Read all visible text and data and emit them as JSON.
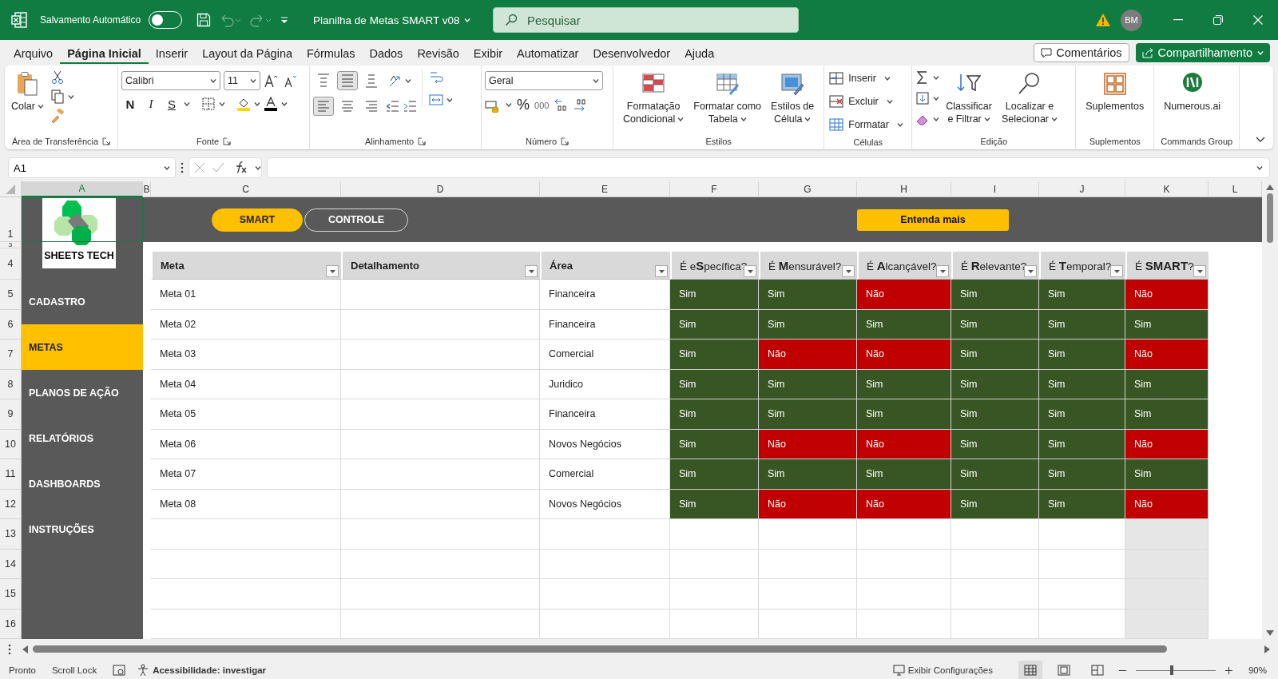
{
  "titlebar": {
    "autosave": {
      "label": "Salvamento Automático",
      "on": false
    },
    "title": "Planilha de Metas SMART v08",
    "search": {
      "placeholder": "Pesquisar"
    },
    "avatar": "BM"
  },
  "menu": {
    "tabs": [
      {
        "label": "Arquivo",
        "selected": false
      },
      {
        "label": "Página Inicial",
        "selected": true
      },
      {
        "label": "Inserir",
        "selected": false
      },
      {
        "label": "Layout da Página",
        "selected": false
      },
      {
        "label": "Fórmulas",
        "selected": false
      },
      {
        "label": "Dados",
        "selected": false
      },
      {
        "label": "Revisão",
        "selected": false
      },
      {
        "label": "Exibir",
        "selected": false
      },
      {
        "label": "Automatizar",
        "selected": false
      },
      {
        "label": "Desenvolvedor",
        "selected": false
      },
      {
        "label": "Ajuda",
        "selected": false
      }
    ],
    "comments": "Comentários",
    "share": "Compartilhamento"
  },
  "ribbon": {
    "groups": [
      {
        "kind": "clipboard",
        "label": "Área de Transferência",
        "paste": "Colar"
      },
      {
        "kind": "font",
        "label": "Fonte",
        "font_name": "Calibri",
        "font_size": "11",
        "styles": [
          "N",
          "I",
          "S"
        ]
      },
      {
        "kind": "alignment",
        "label": "Alinhamento",
        "vertical": [
          {
            "selected": false
          },
          {
            "selected": true
          },
          {
            "selected": false
          }
        ],
        "horizontal": [
          {
            "selected": true
          },
          {
            "selected": false
          },
          {
            "selected": false
          }
        ]
      },
      {
        "kind": "number",
        "label": "Número",
        "format": "Geral",
        "symbols": [
          "%",
          "000"
        ]
      },
      {
        "kind": "large",
        "label": "Estilos",
        "buttons": [
          {
            "kind": "conditional",
            "lines": [
              "Formatação",
              "Condicional"
            ],
            "menu": true
          },
          {
            "kind": "table",
            "lines": [
              "Formatar como",
              "Tabela"
            ],
            "menu": true
          },
          {
            "kind": "cellstyle",
            "lines": [
              "Estilos de",
              "Célula"
            ],
            "menu": true
          }
        ]
      },
      {
        "kind": "cells",
        "label": "Células",
        "buttons": [
          {
            "kind": "insert",
            "label": "Inserir"
          },
          {
            "kind": "delete",
            "label": "Excluir"
          },
          {
            "kind": "format",
            "label": "Formatar"
          }
        ]
      },
      {
        "kind": "editing",
        "label": "Edição",
        "buttons": [
          {
            "kind": "sort",
            "lines": [
              "Classificar",
              "e Filtrar"
            ],
            "menu": true
          },
          {
            "kind": "find",
            "lines": [
              "Localizar e",
              "Selecionar"
            ],
            "menu": true
          }
        ]
      },
      {
        "kind": "large",
        "label": "Suplementos",
        "buttons": [
          {
            "kind": "addins",
            "lines": [
              "Suplementos"
            ],
            "menu": false
          }
        ]
      },
      {
        "kind": "large",
        "label": "Commands Group",
        "buttons": [
          {
            "kind": "numerous",
            "lines": [
              "Numerous.ai"
            ],
            "menu": false
          }
        ]
      }
    ]
  },
  "formula_bar": {
    "name_box": "A1"
  },
  "sheet": {
    "columns": [
      {
        "label": "A",
        "selected": true
      },
      {
        "label": "B",
        "selected": false
      },
      {
        "label": "C",
        "selected": false
      },
      {
        "label": "D",
        "selected": false
      },
      {
        "label": "E",
        "selected": false
      },
      {
        "label": "F",
        "selected": false
      },
      {
        "label": "G",
        "selected": false
      },
      {
        "label": "H",
        "selected": false
      },
      {
        "label": "I",
        "selected": false
      },
      {
        "label": "J",
        "selected": false
      },
      {
        "label": "K",
        "selected": false
      },
      {
        "label": "L",
        "selected": false
      }
    ],
    "row_numbers": [
      "1",
      "3",
      "4",
      "5",
      "6",
      "7",
      "8",
      "9",
      "10",
      "11",
      "12",
      "13",
      "14",
      "15",
      "16"
    ],
    "logo": "SHEETS TECH",
    "nav_buttons": [
      {
        "label": "SMART",
        "selected": true
      },
      {
        "label": "CONTROLE",
        "selected": false
      }
    ],
    "info_button": "Entenda mais",
    "sidebar": [
      {
        "label": "CADASTRO",
        "selected": false
      },
      {
        "label": "METAS",
        "selected": true
      },
      {
        "label": "PLANOS DE AÇÃO",
        "selected": false
      },
      {
        "label": "RELATÓRIOS",
        "selected": false
      },
      {
        "label": "DASHBOARDS",
        "selected": false
      },
      {
        "label": "INSTRUÇÕES",
        "selected": false
      }
    ],
    "table": {
      "columns": [
        "Meta",
        "Detalhamento",
        "Área",
        "É e**S**pecífica?",
        "É **M**ensurável?",
        "É **A**lcançável?",
        "É **R**elevante?",
        "É **T**emporal?",
        "É **SMART**?"
      ],
      "rows": [
        {
          "meta": "Meta 01",
          "area": "Financeira",
          "checks": [
            {
              "text": "Sim",
              "color": "#375623"
            },
            {
              "text": "Sim",
              "color": "#375623"
            },
            {
              "text": "Não",
              "color": "#c00000"
            },
            {
              "text": "Sim",
              "color": "#375623"
            },
            {
              "text": "Sim",
              "color": "#375623"
            },
            {
              "text": "Não",
              "color": "#c00000"
            }
          ]
        },
        {
          "meta": "Meta 02",
          "area": "Financeira",
          "checks": [
            {
              "text": "Sim",
              "color": "#375623"
            },
            {
              "text": "Sim",
              "color": "#375623"
            },
            {
              "text": "Sim",
              "color": "#375623"
            },
            {
              "text": "Sim",
              "color": "#375623"
            },
            {
              "text": "Sim",
              "color": "#375623"
            },
            {
              "text": "Sim",
              "color": "#375623"
            }
          ]
        },
        {
          "meta": "Meta 03",
          "area": "Comercial",
          "checks": [
            {
              "text": "Sim",
              "color": "#375623"
            },
            {
              "text": "Não",
              "color": "#c00000"
            },
            {
              "text": "Não",
              "color": "#c00000"
            },
            {
              "text": "Sim",
              "color": "#375623"
            },
            {
              "text": "Sim",
              "color": "#375623"
            },
            {
              "text": "Não",
              "color": "#c00000"
            }
          ]
        },
        {
          "meta": "Meta 04",
          "area": "Juridico",
          "checks": [
            {
              "text": "Sim",
              "color": "#375623"
            },
            {
              "text": "Sim",
              "color": "#375623"
            },
            {
              "text": "Sim",
              "color": "#375623"
            },
            {
              "text": "Sim",
              "color": "#375623"
            },
            {
              "text": "Sim",
              "color": "#375623"
            },
            {
              "text": "Sim",
              "color": "#375623"
            }
          ]
        },
        {
          "meta": "Meta 05",
          "area": "Financeira",
          "checks": [
            {
              "text": "Sim",
              "color": "#375623"
            },
            {
              "text": "Sim",
              "color": "#375623"
            },
            {
              "text": "Sim",
              "color": "#375623"
            },
            {
              "text": "Sim",
              "color": "#375623"
            },
            {
              "text": "Sim",
              "color": "#375623"
            },
            {
              "text": "Sim",
              "color": "#375623"
            }
          ]
        },
        {
          "meta": "Meta 06",
          "area": "Novos Negócios",
          "checks": [
            {
              "text": "Sim",
              "color": "#375623"
            },
            {
              "text": "Não",
              "color": "#c00000"
            },
            {
              "text": "Não",
              "color": "#c00000"
            },
            {
              "text": "Sim",
              "color": "#375623"
            },
            {
              "text": "Sim",
              "color": "#375623"
            },
            {
              "text": "Não",
              "color": "#c00000"
            }
          ]
        },
        {
          "meta": "Meta 07",
          "area": "Comercial",
          "checks": [
            {
              "text": "Sim",
              "color": "#375623"
            },
            {
              "text": "Sim",
              "color": "#375623"
            },
            {
              "text": "Sim",
              "color": "#375623"
            },
            {
              "text": "Sim",
              "color": "#375623"
            },
            {
              "text": "Sim",
              "color": "#375623"
            },
            {
              "text": "Sim",
              "color": "#375623"
            }
          ]
        },
        {
          "meta": "Meta 08",
          "area": "Novos Negócios",
          "checks": [
            {
              "text": "Sim",
              "color": "#375623"
            },
            {
              "text": "Não",
              "color": "#c00000"
            },
            {
              "text": "Não",
              "color": "#c00000"
            },
            {
              "text": "Sim",
              "color": "#375623"
            },
            {
              "text": "Sim",
              "color": "#375623"
            },
            {
              "text": "Não",
              "color": "#c00000"
            }
          ]
        }
      ]
    }
  },
  "status_bar": {
    "ready": "Pronto",
    "scroll_lock": "Scroll Lock",
    "accessibility": "Acessibilidade: investigar",
    "view_settings": "Exibir Configurações",
    "views": [
      {
        "selected": true
      },
      {
        "selected": false
      },
      {
        "selected": false
      }
    ],
    "zoom": {
      "level": 0.45,
      "reading": "90%"
    }
  }
}
